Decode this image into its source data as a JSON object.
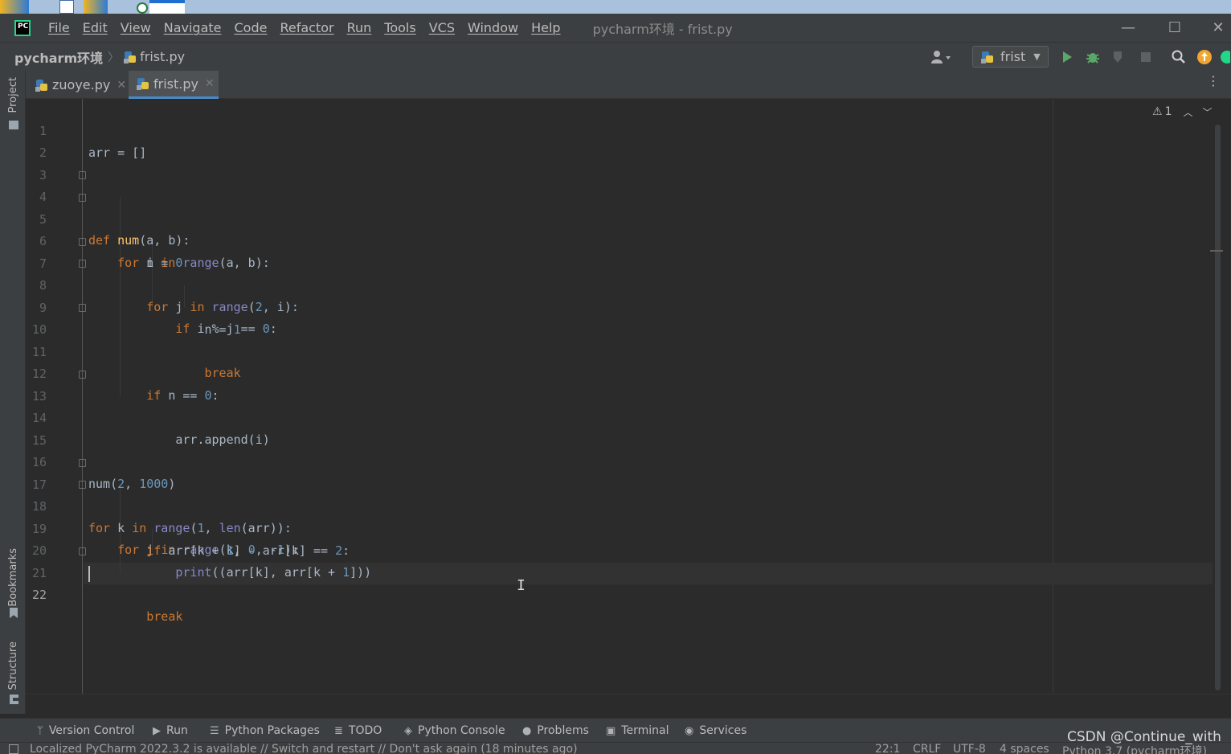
{
  "window": {
    "menu": [
      "File",
      "Edit",
      "View",
      "Navigate",
      "Code",
      "Refactor",
      "Run",
      "Tools",
      "VCS",
      "Window",
      "Help"
    ],
    "title": "pycharm环境 - frist.py",
    "minimize_glyph": "—",
    "maximize_glyph": "☐",
    "close_glyph": "✕"
  },
  "navbar": {
    "project": "pycharm环境",
    "separator": "〉",
    "file": "frist.py",
    "run_config": "frist"
  },
  "left_strip": {
    "project_label": "Project",
    "bookmarks_label": "Bookmarks",
    "structure_label": "Structure"
  },
  "tabs": [
    {
      "label": "zuoye.py",
      "close": "✕"
    },
    {
      "label": "frist.py",
      "close": "✕"
    }
  ],
  "editor": {
    "warning_count": "1",
    "line_numbers": [
      "1",
      "2",
      "3",
      "4",
      "5",
      "6",
      "7",
      "8",
      "9",
      "10",
      "11",
      "12",
      "13",
      "14",
      "15",
      "16",
      "17",
      "18",
      "19",
      "20",
      "21",
      "22"
    ],
    "code_lines": [
      "arr = []",
      "",
      "",
      "def num(a, b):",
      "    for i in range(a, b):",
      "        n = 0",
      "        for j in range(2, i):",
      "            if i % j == 0:",
      "                n = 1",
      "                break",
      "",
      "        if n == 0:",
      "            arr.append(i)",
      "",
      "",
      "num(2, 1000)",
      "for k in range(1, len(arr)):",
      "    for j in range(k, 0, -1):",
      "        if arr[k + 1] - arr[k] == 2:",
      "            print((arr[k], arr[k + 1]))",
      "        break",
      ""
    ],
    "current_line": "22"
  },
  "tool_windows": [
    "Version Control",
    "Run",
    "Python Packages",
    "TODO",
    "Python Console",
    "Problems",
    "Terminal",
    "Services"
  ],
  "status": {
    "message": "Localized PyCharm 2022.3.2 is available // Switch and restart // Don't ask again (18 minutes ago)",
    "position": "22:1",
    "line_sep": "CRLF",
    "encoding": "UTF-8",
    "indent": "4 spaces",
    "interpreter": "Python 3.7 (pycharm环境)"
  },
  "watermark": "CSDN @Continue_with",
  "colors": {
    "keyword": "#cc7832",
    "function": "#ffc66d",
    "number": "#6897bb",
    "builtin": "#8888c6",
    "identifier": "#a9b7c6",
    "run_green": "#59a869",
    "tab_underline": "#4a88c7"
  },
  "icons": [
    "app-logo-icon",
    "python-file-icon",
    "user-icon",
    "run-icon",
    "debug-icon",
    "coverage-icon",
    "stop-icon",
    "search-icon",
    "update-icon",
    "kebab-menu-icon",
    "warning-icon",
    "chevron-up-icon",
    "chevron-down-icon",
    "folder-icon",
    "bookmark-icon",
    "structure-icon",
    "branch-icon",
    "layers-icon",
    "list-icon",
    "python-icon",
    "info-icon",
    "terminal-icon",
    "services-icon"
  ]
}
